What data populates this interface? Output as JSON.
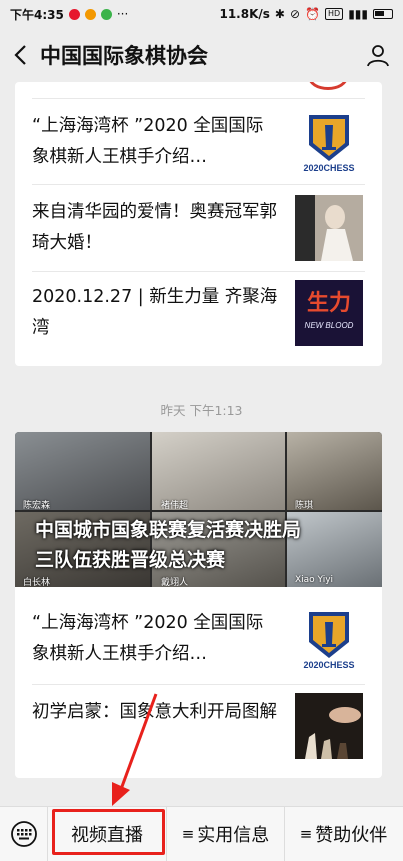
{
  "statusbar": {
    "time": "下午4:35",
    "speed": "11.8K/s",
    "battery_badge": "HD"
  },
  "header": {
    "title": "中国国际象棋协会"
  },
  "card1": {
    "items": [
      {
        "title": "“上海海湾杯 ”2020 全国国际象棋新人王棋手介绍…",
        "thumb_label": "2020CHESS"
      },
      {
        "title": "来自清华园的爱情！奥赛冠军郭琦大婚！"
      },
      {
        "title": "2020.12.27 | 新生力量 齐聚海湾",
        "thumb_label": "NEW BLOOD"
      }
    ]
  },
  "timestamp": "昨天 下午1:13",
  "card2": {
    "banner": {
      "title_line1": "中国城市国象联赛复活赛决胜局",
      "title_line2": "三队伍获胜晋级总决赛",
      "labels": [
        "陈宏森",
        "褚伟超",
        "陈琪",
        "白长林",
        "戴翊人",
        "Xiao Yiyi"
      ]
    },
    "items": [
      {
        "title": "“上海海湾杯 ”2020 全国国际象棋新人王棋手介绍…",
        "thumb_label": "2020CHESS"
      },
      {
        "title": "初学启蒙：国象意大利开局图解"
      }
    ]
  },
  "bottom_menu": {
    "item1": "视频直播",
    "item2": "实用信息",
    "item3": "赞助伙伴",
    "hamburger": "≡"
  },
  "colors": {
    "highlight": "#e8211c",
    "background": "#ededed"
  }
}
